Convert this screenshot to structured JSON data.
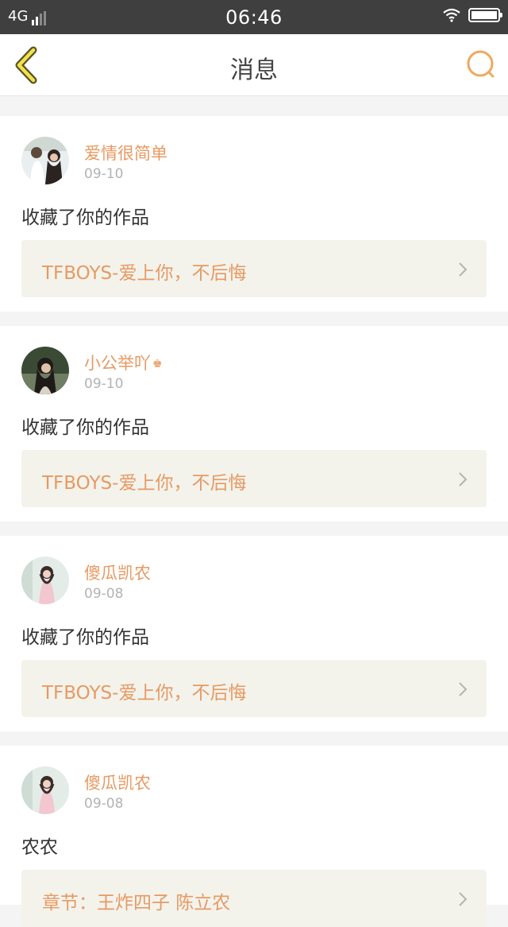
{
  "status_bar": {
    "network": "4G",
    "time": "06:46"
  },
  "nav": {
    "title": "消息",
    "back_icon": "chevron-left-icon",
    "search_icon": "search-icon",
    "accent_color": "#e79a63"
  },
  "messages": [
    {
      "user": "爱情很简单",
      "date": "09-10",
      "action": "收藏了你的作品",
      "work_title": "TFBOYS-爱上你，不后悔",
      "badge": ""
    },
    {
      "user": "小公举吖",
      "date": "09-10",
      "action": "收藏了你的作品",
      "work_title": "TFBOYS-爱上你，不后悔",
      "badge": "♚"
    },
    {
      "user": "傻瓜凯农",
      "date": "09-08",
      "action": "收藏了你的作品",
      "work_title": "TFBOYS-爱上你，不后悔",
      "badge": ""
    },
    {
      "user": "傻瓜凯农",
      "date": "09-08",
      "action": "农农",
      "work_title": "章节：王炸四子 陈立农",
      "badge": ""
    }
  ]
}
